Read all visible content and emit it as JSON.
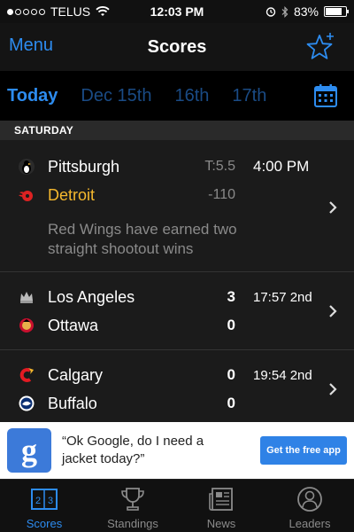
{
  "status_bar": {
    "carrier": "TELUS",
    "time": "12:03 PM",
    "battery_percent": "83%",
    "battery_level": 0.83,
    "signal_bars_filled": 1,
    "signal_bars_total": 5
  },
  "nav": {
    "menu_label": "Menu",
    "title": "Scores",
    "favorite_icon": "star-plus-icon"
  },
  "date_tabs": [
    {
      "label": "Today",
      "active": true
    },
    {
      "label": "Dec 15th",
      "active": false
    },
    {
      "label": "16th",
      "active": false
    },
    {
      "label": "17th",
      "active": false
    }
  ],
  "calendar_icon": "calendar-icon",
  "section_header": "SATURDAY",
  "games": [
    {
      "away": {
        "name": "Pittsburgh",
        "line": "T:5.5",
        "logo": "penguin-logo"
      },
      "home": {
        "name": "Detroit",
        "line": "-110",
        "favorite": true,
        "logo": "winged-wheel-logo"
      },
      "time": "4:00 PM",
      "note": "Red Wings have earned two straight shootout wins"
    },
    {
      "away": {
        "name": "Los Angeles",
        "score": "3",
        "logo": "crown-logo"
      },
      "home": {
        "name": "Ottawa",
        "score": "0",
        "logo": "senator-logo"
      },
      "time": "17:57 2nd"
    },
    {
      "away": {
        "name": "Calgary",
        "score": "0",
        "logo": "flaming-c-logo"
      },
      "home": {
        "name": "Buffalo",
        "score": "0",
        "logo": "buffalo-logo"
      },
      "time": "19:54 2nd"
    }
  ],
  "ad": {
    "logo_letter": "g",
    "text": "“Ok Google, do I need a jacket today?”",
    "cta": "Get the free app"
  },
  "tabs": [
    {
      "label": "Scores",
      "icon": "scoreboard-icon",
      "active": true
    },
    {
      "label": "Standings",
      "icon": "trophy-icon",
      "active": false
    },
    {
      "label": "News",
      "icon": "newspaper-icon",
      "active": false
    },
    {
      "label": "Leaders",
      "icon": "person-icon",
      "active": false
    }
  ],
  "colors": {
    "accent": "#2d8cf0",
    "favorite_team": "#f5b82e",
    "muted": "#8a8a8a"
  }
}
